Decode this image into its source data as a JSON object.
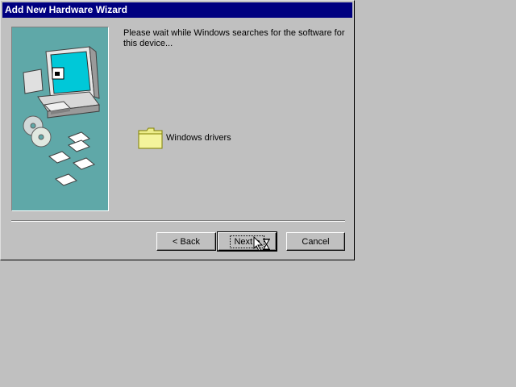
{
  "window": {
    "title": "Add New Hardware Wizard"
  },
  "message": "Please wait while Windows searches for the software for this device...",
  "search_item": {
    "icon": "folder-icon",
    "label": "Windows drivers"
  },
  "buttons": {
    "back": "< Back",
    "next": "Next >",
    "cancel": "Cancel"
  },
  "colors": {
    "titlebar": "#000080",
    "illustration_bg": "#5fa8a8",
    "face": "#c0c0c0"
  }
}
